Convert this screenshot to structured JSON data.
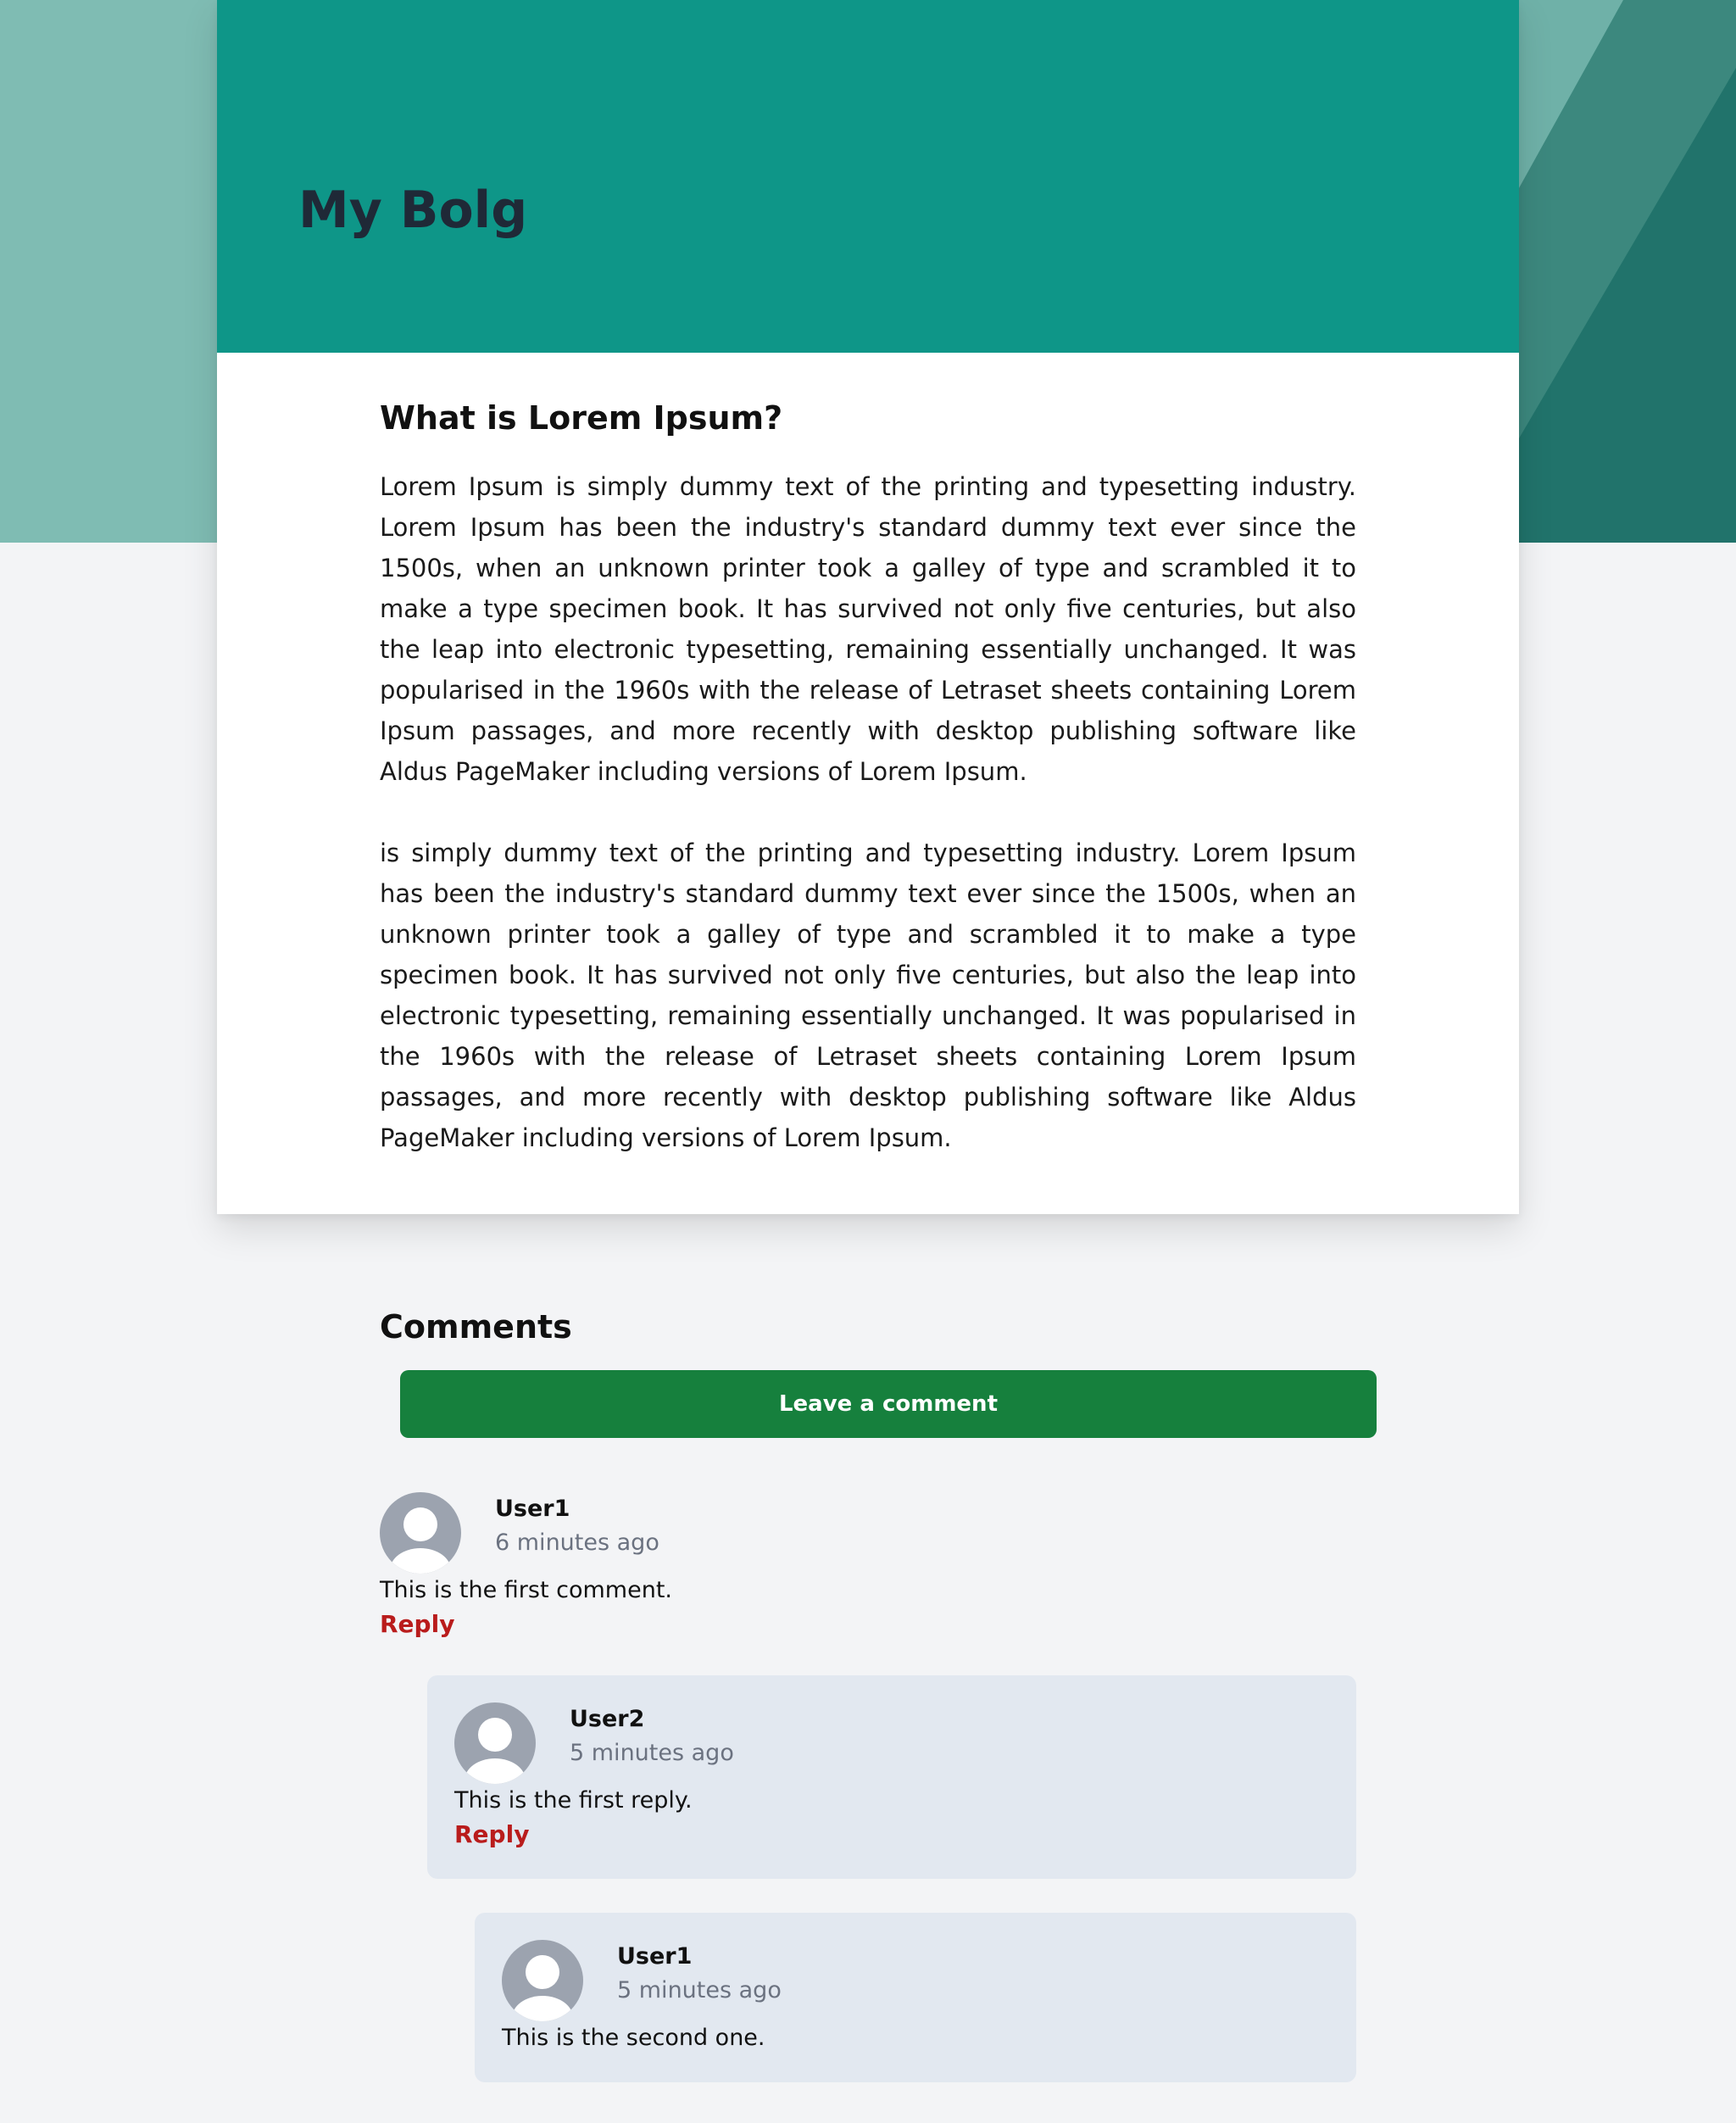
{
  "blog": {
    "title": "My Bolg"
  },
  "article": {
    "title": "What is Lorem Ipsum?",
    "paragraphs": [
      "Lorem Ipsum is simply dummy text of the printing and typesetting industry. Lorem Ipsum has been the industry's standard dummy text ever since the 1500s, when an unknown printer took a galley of type and scrambled it to make a type specimen book. It has survived not only five centuries, but also the leap into electronic typesetting, remaining essentially unchanged. It was popularised in the 1960s with the release of Letraset sheets containing Lorem Ipsum passages, and more recently with desktop publishing software like Aldus PageMaker including versions of Lorem Ipsum.",
      "is simply dummy text of the printing and typesetting industry. Lorem Ipsum has been the industry's standard dummy text ever since the 1500s, when an unknown printer took a galley of type and scrambled it to make a type specimen book. It has survived not only five centuries, but also the leap into electronic typesetting, remaining essentially unchanged. It was popularised in the 1960s with the release of Letraset sheets containing Lorem Ipsum passages, and more recently with desktop publishing software like Aldus PageMaker including versions of Lorem Ipsum."
    ]
  },
  "comments": {
    "title": "Comments",
    "leave_label": "Leave a comment",
    "items": [
      {
        "user": "User1",
        "time": "6 minutes ago",
        "text": "This is the first comment.",
        "reply_label": "Reply"
      },
      {
        "user": "User2",
        "time": "5 minutes ago",
        "text": "This is the first reply.",
        "reply_label": "Reply"
      },
      {
        "user": "User1",
        "time": "5 minutes ago",
        "text": "This is the second one."
      }
    ]
  },
  "colors": {
    "header": "#0e9688",
    "background_left": "#7fbcb3",
    "background_right_dark": "#21736b",
    "button": "#16803d",
    "reply_link": "#b91c1c",
    "reply_box": "#e2e8f0"
  },
  "icons": {
    "avatar": "user-avatar-icon"
  }
}
